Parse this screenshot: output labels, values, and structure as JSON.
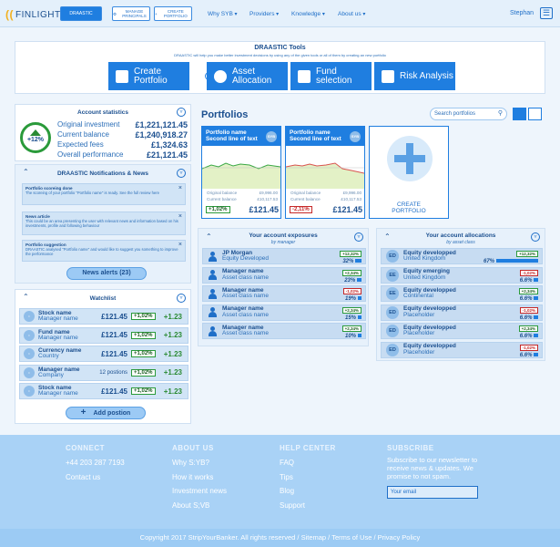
{
  "brand": "FINLIGHT",
  "nav": {
    "btn_draastic": "DRAASTIC",
    "btn_manage": "MANAGE PRINCIPALS",
    "btn_create": "CREATE PORTFOLIO",
    "links": [
      "Why SYB",
      "Providers",
      "Knowledge",
      "About us"
    ],
    "user": "Stephan"
  },
  "tools": {
    "title": "DRAASTIC Tools",
    "subtitle": "DRAASTIC will help you make better investment decisions by using any of the given tools or all of them by creating an new portfolio",
    "buttons": [
      "Create Portfolio",
      "Asset Allocation",
      "Fund selection",
      "Risk Analysis"
    ]
  },
  "stats": {
    "title": "Account statistics",
    "performance_badge": "+12%",
    "rows": [
      {
        "label": "Original investment",
        "value": "£1,221,121.45"
      },
      {
        "label": "Current balance",
        "value": "£1,240,918.27"
      },
      {
        "label": "Expected fees",
        "value": "£1,324.63"
      },
      {
        "label": "Overall performance",
        "value": "£21,121.45"
      }
    ]
  },
  "notifications": {
    "title": "DRAASTIC Notifications & News",
    "items": [
      {
        "title": "Portfolio scoreing done",
        "text": "The scoreing of your portfolio \"Portfolio name\" is ready. See the full review here"
      },
      {
        "title": "News article",
        "text": "This could be an area presenting the user with relevant news and information based on his investments, profile and following behaviour"
      },
      {
        "title": "Portfolio suggestion",
        "text": "DRAASTIC analysed \"Portfolio name\" and would like to suggest you something to improve the performance"
      }
    ],
    "button": "News alerts (23)"
  },
  "watchlist": {
    "title": "Watchlist",
    "rows": [
      {
        "name": "Stock name",
        "sub": "Manager name",
        "mid": "",
        "value": "£121.45",
        "badge": "+1,02%",
        "change": "+1.23"
      },
      {
        "name": "Fund name",
        "sub": "Manager name",
        "mid": "",
        "value": "£121.45",
        "badge": "+1,02%",
        "change": "+1.23"
      },
      {
        "name": "Currency name",
        "sub": "Country",
        "mid": "",
        "value": "£121.45",
        "badge": "+1,02%",
        "change": "+1.23"
      },
      {
        "name": "Manager name",
        "sub": "Company",
        "mid": "12 postions",
        "value": "",
        "badge": "+1,02%",
        "change": "+1.23"
      },
      {
        "name": "Stock name",
        "sub": "Manager name",
        "mid": "",
        "value": "£121.45",
        "badge": "+1,02%",
        "change": "+1.23"
      }
    ],
    "button": "Add postion"
  },
  "portfolios": {
    "title": "Portfolios",
    "search_placeholder": "Search portfolios",
    "cards": [
      {
        "name": "Portfolio name",
        "sub": "Second line of text",
        "orig_label": "Original balance",
        "orig": "£9,996.00",
        "curr_label": "Current balance",
        "curr": "£10,117.53",
        "badge": "+1,02%",
        "amount": "£121.45",
        "positive": true
      },
      {
        "name": "Portfolio name",
        "sub": "Second line of text",
        "orig_label": "Original balance",
        "orig": "£9,996.00",
        "curr_label": "Current balance",
        "curr": "£10,117.53",
        "badge": "-2,11%",
        "amount": "£121.45",
        "positive": false
      }
    ],
    "create_label": "CREATE PORTFOLIO"
  },
  "exposures": {
    "title": "Your account exposures",
    "subtitle": "by manager",
    "rows": [
      {
        "name": "JP Morgan",
        "sub": "Equity Developed",
        "badge": "+12,32%",
        "pct": "32%",
        "share": 0.32,
        "positive": true
      },
      {
        "name": "Manager name",
        "sub": "Asset class name",
        "badge": "+2,34%",
        "pct": "23%",
        "share": 0.23,
        "positive": true
      },
      {
        "name": "Manager name",
        "sub": "Asset class name",
        "badge": "-1,02%",
        "pct": "19%",
        "share": 0.19,
        "positive": false
      },
      {
        "name": "Manager name",
        "sub": "Asset class name",
        "badge": "+2,34%",
        "pct": "15%",
        "share": 0.15,
        "positive": true
      },
      {
        "name": "Manager name",
        "sub": "Asset class name",
        "badge": "+2,34%",
        "pct": "10%",
        "share": 0.1,
        "positive": true
      }
    ]
  },
  "allocations": {
    "title": "Your account allocations",
    "subtitle": "by asset class",
    "rows": [
      {
        "abbr": "ED",
        "name": "Equity developped",
        "sub": "United Kingdom",
        "badge": "+12,32%",
        "pct": "67%",
        "share": 0.67,
        "positive": true
      },
      {
        "abbr": "EE",
        "name": "Equity emerging",
        "sub": "United Kingdom",
        "badge": "-1,02%",
        "pct": "6.6%",
        "share": 0.066,
        "positive": false
      },
      {
        "abbr": "EE",
        "name": "Equity developped",
        "sub": "Continental",
        "badge": "+2,34%",
        "pct": "6.6%",
        "share": 0.066,
        "positive": true
      },
      {
        "abbr": "ED",
        "name": "Equity developped",
        "sub": "Placeholder",
        "badge": "-1,02%",
        "pct": "6.6%",
        "share": 0.066,
        "positive": false
      },
      {
        "abbr": "ED",
        "name": "Equity developped",
        "sub": "Placeholder",
        "badge": "+2,34%",
        "pct": "6.6%",
        "share": 0.066,
        "positive": true
      },
      {
        "abbr": "ED",
        "name": "Equity developped",
        "sub": "Placeholder",
        "badge": "-1,02%",
        "pct": "6.6%",
        "share": 0.066,
        "positive": false
      }
    ]
  },
  "footer": {
    "connect": {
      "title": "CONNECT",
      "phone": "+44 203 287 7193",
      "contact": "Contact us"
    },
    "about": {
      "title": "ABOUT US",
      "links": [
        "Why S:YB?",
        "How it works",
        "Investment news",
        "About S;VB"
      ]
    },
    "help": {
      "title": "HELP CENTER",
      "links": [
        "FAQ",
        "Tips",
        "Blog",
        "Support"
      ]
    },
    "subscribe": {
      "title": "SUBSCRIBE",
      "text": "Subscribe to our newsletter to receive news & updates. We promise to not spam.",
      "placeholder": "Your email"
    },
    "copyright": "Copyright 2017 StripYourBanker. All rights reserved / Sitemap / Terms of Use / Privacy Policy"
  },
  "colors": {
    "accent": "#1f7ee0",
    "positive": "#2a9a3a",
    "negative": "#c62828"
  }
}
